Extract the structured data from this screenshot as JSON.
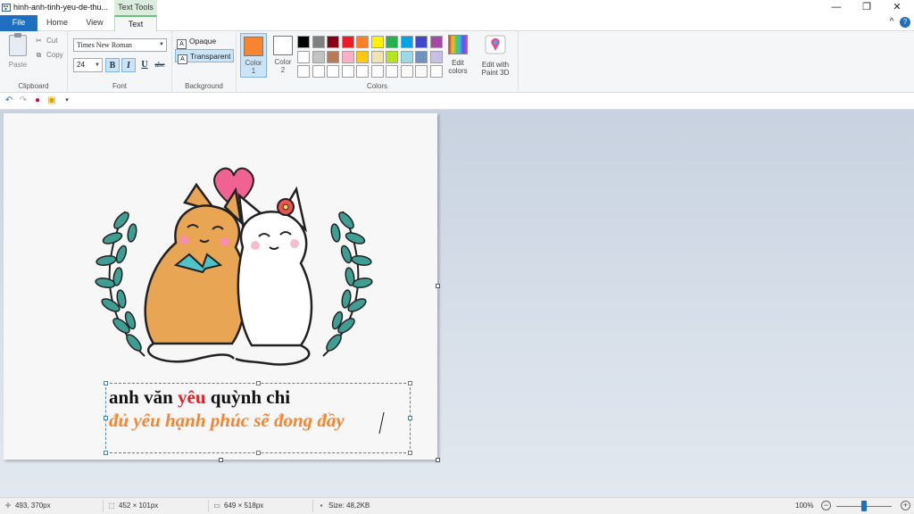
{
  "window": {
    "title": "hinh-anh-tinh-yeu-de-thu...",
    "context_tab_label": "Text Tools",
    "minimize_glyph": "—",
    "restore_glyph": "❐",
    "close_glyph": "✕"
  },
  "tabs": {
    "file": "File",
    "home": "Home",
    "view": "View",
    "text": "Text"
  },
  "help": {
    "chevron": "^",
    "q": "?"
  },
  "ribbon": {
    "clipboard": {
      "paste": "Paste",
      "cut": "Cut",
      "copy": "Copy",
      "label": "Clipboard"
    },
    "font": {
      "family": "Times New Roman",
      "size": "24",
      "bold": "B",
      "italic": "I",
      "underline": "U",
      "strike": "abc",
      "label": "Font"
    },
    "background": {
      "opaque": "Opaque",
      "transparent": "Transparent",
      "label": "Background"
    },
    "colors": {
      "color1_label": "Color",
      "color1_num": "1",
      "color2_label": "Color",
      "color2_num": "2",
      "color1_value": "#f7852f",
      "color2_value": "#ffffff",
      "label": "Colors",
      "palette": [
        [
          "#000000",
          "#7f7f7f",
          "#880015",
          "#ed1c24",
          "#ff7f27",
          "#fff200",
          "#22b14c",
          "#00a2e8",
          "#3f48cc",
          "#a349a4"
        ],
        [
          "#ffffff",
          "#c3c3c3",
          "#b97a57",
          "#ffaec9",
          "#ffc90e",
          "#efe4b0",
          "#b5e61d",
          "#99d9ea",
          "#7092be",
          "#c8bfe7"
        ],
        [
          "#ffffff",
          "#ffffff",
          "#ffffff",
          "#ffffff",
          "#ffffff",
          "#ffffff",
          "#ffffff",
          "#ffffff",
          "#ffffff",
          "#ffffff"
        ]
      ]
    },
    "edit_colors": {
      "line1": "Edit",
      "line2": "colors"
    },
    "paint3d": {
      "line1": "Edit with",
      "line2": "Paint 3D"
    }
  },
  "canvas_text": {
    "line1_a": "anh văn ",
    "line1_red": "yêu",
    "line1_b": " quỳnh chi",
    "line2": "đủ yêu hạnh phúc sẽ đong đầy"
  },
  "status": {
    "cursor": "493, 370px",
    "selection": "452 × 101px",
    "image_size": "649 × 518px",
    "file_size": "Size: 48,2KB",
    "zoom": "100%",
    "zoom_level": 0.5
  }
}
